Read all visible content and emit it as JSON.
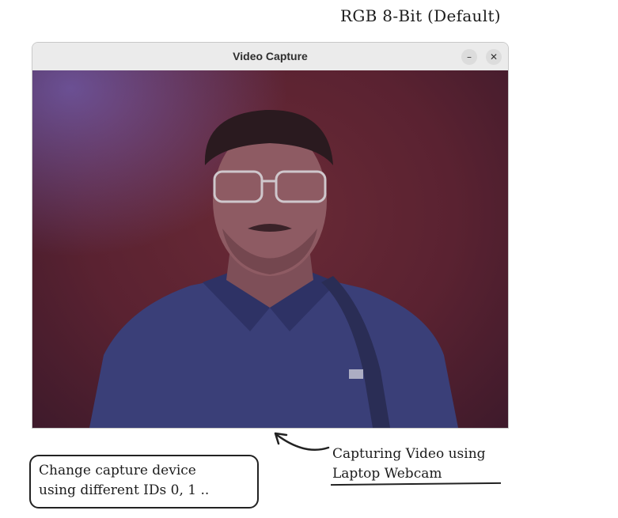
{
  "caption_top": "RGB 8-Bit (Default)",
  "window": {
    "title": "Video Capture",
    "minimize_glyph": "–",
    "close_glyph": "✕"
  },
  "annotations": {
    "capture_line1": "Capturing Video using",
    "capture_line2": "Laptop Webcam",
    "device_line1": "Change capture device",
    "device_line2": "using different IDs 0, 1 .."
  },
  "colors": {
    "background_wall": "#5a2231",
    "shirt": "#3a3f78",
    "skin": "#8e5b63",
    "hair": "#2a1a1f"
  }
}
